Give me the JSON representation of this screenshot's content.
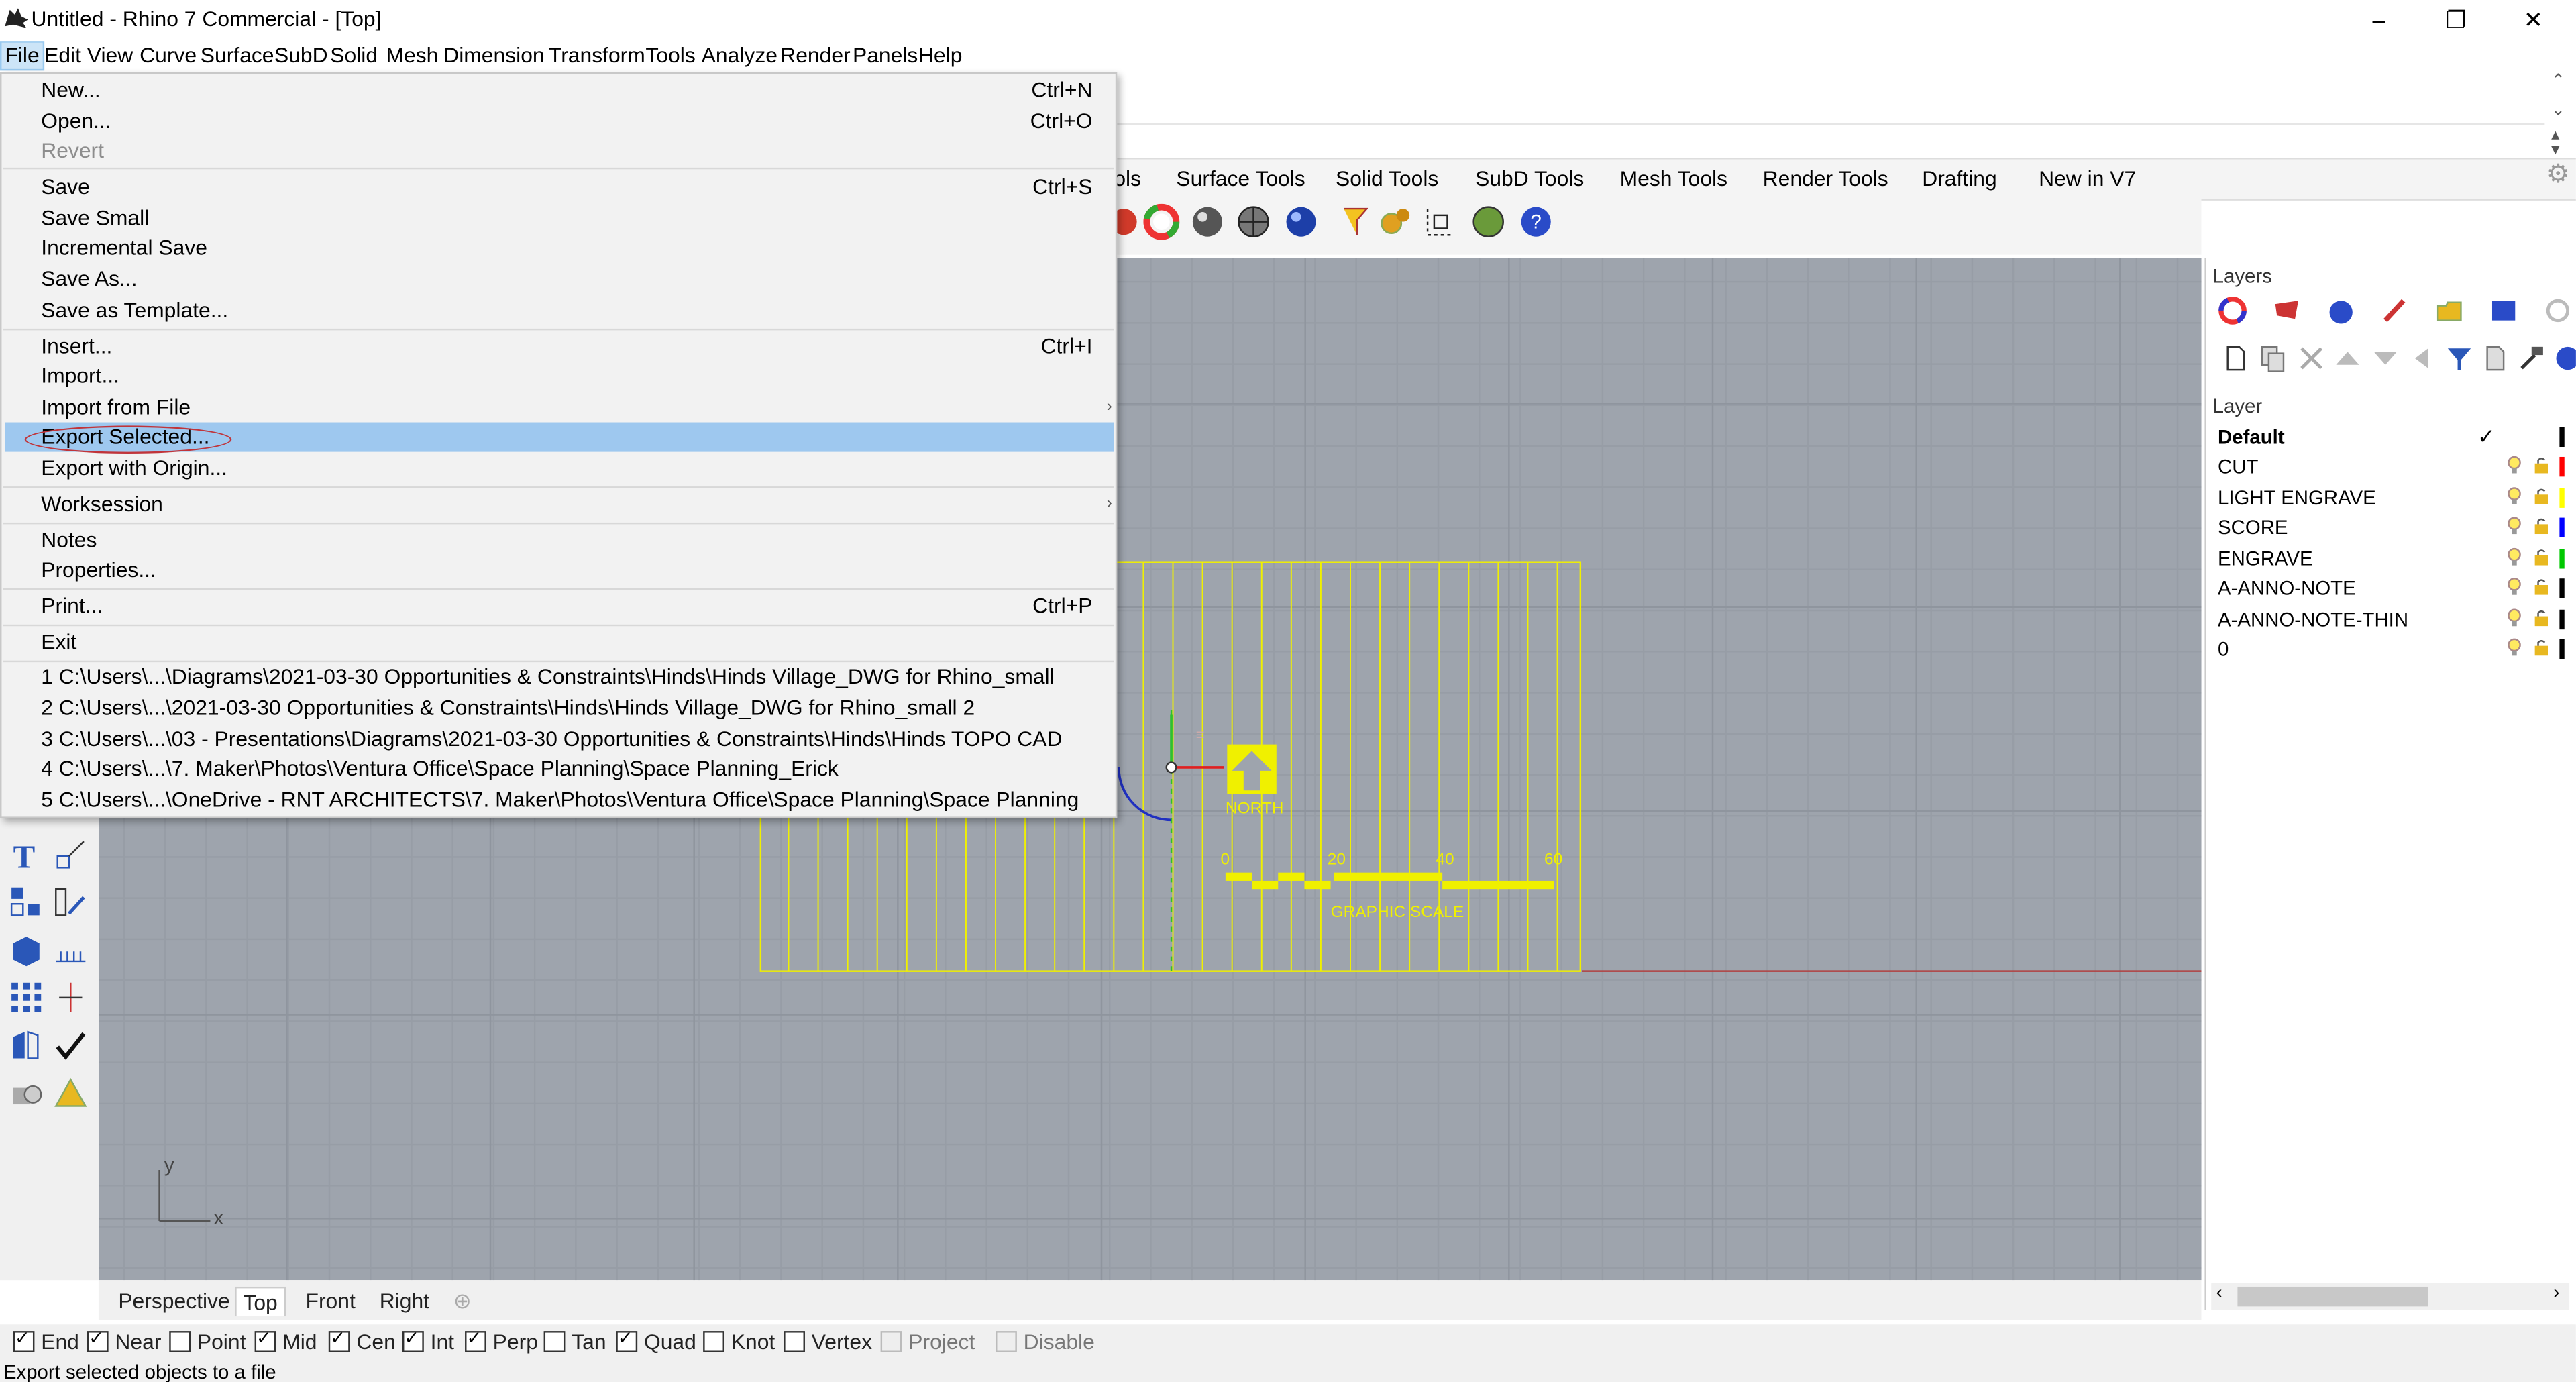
{
  "window": {
    "title": "Untitled - Rhino 7 Commercial - [Top]",
    "minimize": "–",
    "restore": "❐",
    "close": "✕"
  },
  "menubar": [
    "File",
    "Edit",
    "View",
    "Curve",
    "Surface",
    "SubD",
    "Solid",
    "Mesh",
    "Dimension",
    "Transform",
    "Tools",
    "Analyze",
    "Render",
    "Panels",
    "Help"
  ],
  "toolbar_tabs": [
    "ols",
    "Surface Tools",
    "Solid Tools",
    "SubD Tools",
    "Mesh Tools",
    "Render Tools",
    "Drafting",
    "New in V7"
  ],
  "file_menu": {
    "new": {
      "label": "New...",
      "shortcut": "Ctrl+N"
    },
    "open": {
      "label": "Open...",
      "shortcut": "Ctrl+O"
    },
    "revert": {
      "label": "Revert"
    },
    "save": {
      "label": "Save",
      "shortcut": "Ctrl+S"
    },
    "save_small": {
      "label": "Save Small"
    },
    "incremental_save": {
      "label": "Incremental Save"
    },
    "save_as": {
      "label": "Save As..."
    },
    "save_as_template": {
      "label": "Save as Template..."
    },
    "insert": {
      "label": "Insert...",
      "shortcut": "Ctrl+I"
    },
    "import": {
      "label": "Import..."
    },
    "import_from_file": {
      "label": "Import from File"
    },
    "export_selected": {
      "label": "Export Selected..."
    },
    "export_with_origin": {
      "label": "Export with Origin..."
    },
    "worksession": {
      "label": "Worksession"
    },
    "notes": {
      "label": "Notes"
    },
    "properties": {
      "label": "Properties..."
    },
    "print": {
      "label": "Print...",
      "shortcut": "Ctrl+P"
    },
    "exit": {
      "label": "Exit"
    },
    "recent": [
      "1 C:\\Users\\...\\Diagrams\\2021-03-30 Opportunities & Constraints\\Hinds\\Hinds Village_DWG for Rhino_small",
      "2 C:\\Users\\...\\2021-03-30 Opportunities & Constraints\\Hinds\\Hinds Village_DWG for Rhino_small 2",
      "3 C:\\Users\\...\\03 - Presentations\\Diagrams\\2021-03-30 Opportunities & Constraints\\Hinds\\Hinds TOPO CAD",
      "4 C:\\Users\\...\\7. Maker\\Photos\\Ventura Office\\Space Planning\\Space Planning_Erick",
      "5 C:\\Users\\...\\OneDrive - RNT ARCHITECTS\\7. Maker\\Photos\\Ventura Office\\Space Planning\\Space Planning"
    ]
  },
  "viewport": {
    "north_label": "NORTH",
    "scale_ticks": [
      "0",
      "20",
      "40",
      "60"
    ],
    "scale_label": "GRAPHIC SCALE",
    "axis_y": "y",
    "axis_x": "x",
    "drawing_color": "#ffff00"
  },
  "viewport_tabs": [
    "Perspective",
    "Top",
    "Front",
    "Right"
  ],
  "layers": {
    "title": "Layers",
    "column_header": "Layer",
    "rows": [
      {
        "name": "Default",
        "color": "#000000",
        "current": true
      },
      {
        "name": "CUT",
        "color": "#ff0000"
      },
      {
        "name": "LIGHT ENGRAVE",
        "color": "#ffff00"
      },
      {
        "name": "SCORE",
        "color": "#0000ff"
      },
      {
        "name": "ENGRAVE",
        "color": "#00ff00"
      },
      {
        "name": "A-ANNO-NOTE",
        "color": "#000000"
      },
      {
        "name": "A-ANNO-NOTE-THIN",
        "color": "#000000"
      },
      {
        "name": "0",
        "color": "#000000"
      }
    ]
  },
  "osnaps": [
    {
      "label": "End",
      "checked": true
    },
    {
      "label": "Near",
      "checked": true
    },
    {
      "label": "Point",
      "checked": false
    },
    {
      "label": "Mid",
      "checked": true
    },
    {
      "label": "Cen",
      "checked": true
    },
    {
      "label": "Int",
      "checked": true
    },
    {
      "label": "Perp",
      "checked": true
    },
    {
      "label": "Tan",
      "checked": false
    },
    {
      "label": "Quad",
      "checked": true
    },
    {
      "label": "Knot",
      "checked": false
    },
    {
      "label": "Vertex",
      "checked": false
    },
    {
      "label": "Project",
      "checked": false,
      "disabled": true
    },
    {
      "label": "Disable",
      "checked": false,
      "disabled": true
    }
  ],
  "status": {
    "text": "Export selected objects to a file"
  }
}
